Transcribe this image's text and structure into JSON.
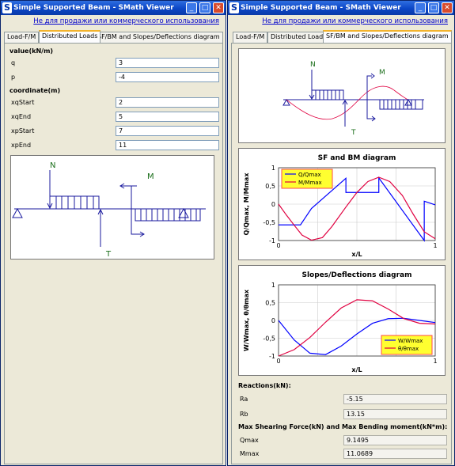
{
  "window_title": "Simple Supported Beam - SMath Viewer",
  "license_link": "Не для продажи или коммерческого использования",
  "tabs": [
    "Load-F/M",
    "Distributed Loads",
    "SF/BM and Slopes/Deflections diagram"
  ],
  "left": {
    "value_header": "value(kN/m)",
    "q_label": "q",
    "q": "3",
    "p_label": "p",
    "p": "-4",
    "coord_header": "coordinate(m)",
    "xqStart_label": "xqStart",
    "xqStart": "2",
    "xqEnd_label": "xqEnd",
    "xqEnd": "5",
    "xpStart_label": "xpStart",
    "xpStart": "7",
    "xpEnd_label": "xpEnd",
    "xpEnd": "11"
  },
  "beam_labels": {
    "N": "N",
    "M": "M",
    "T": "T"
  },
  "right": {
    "reactions_header": "Reactions(kN):",
    "ra_label": "Ra",
    "ra": "-5.15",
    "rb_label": "Rb",
    "rb": "13.15",
    "max_header": "Max Shearing Force(kN) and Max Bending moment(kN*m):",
    "qmax_label": "Qmax",
    "qmax": "9.1495",
    "mmax_label": "Mmax",
    "mmax": "11.0689"
  },
  "chart_data": [
    {
      "type": "line",
      "title": "SF and BM diagram",
      "xlabel": "x/L",
      "ylabel": "Q/Qmax, M/Mmax",
      "xlim": [
        0,
        1
      ],
      "ylim": [
        -1,
        1
      ],
      "xticks": [
        "0",
        "1"
      ],
      "yticks": [
        "1",
        "0,5",
        "0",
        "-0,5",
        "-1"
      ],
      "legend": "top-left",
      "series": [
        {
          "name": "Q/Qmax",
          "color": "#0000ff",
          "x": [
            0,
            0.14,
            0.21,
            0.43,
            0.43,
            0.64,
            0.64,
            0.93,
            0.93,
            1
          ],
          "y": [
            -0.57,
            -0.57,
            -0.12,
            0.71,
            0.32,
            0.32,
            0.72,
            -1.0,
            0.08,
            -0.02
          ]
        },
        {
          "name": "M/Mmax",
          "color": "#e00040",
          "x": [
            0,
            0.05,
            0.1,
            0.15,
            0.21,
            0.28,
            0.34,
            0.43,
            0.5,
            0.57,
            0.64,
            0.71,
            0.79,
            0.86,
            0.93,
            1
          ],
          "y": [
            0,
            -0.3,
            -0.58,
            -0.85,
            -0.99,
            -0.92,
            -0.62,
            -0.08,
            0.32,
            0.62,
            0.74,
            0.62,
            0.24,
            -0.28,
            -0.76,
            -0.95
          ]
        }
      ]
    },
    {
      "type": "line",
      "title": "Slopes/Deflections diagram",
      "xlabel": "x/L",
      "ylabel": "W/Wmax, θ/θmax",
      "xlim": [
        0,
        1
      ],
      "ylim": [
        -1,
        1
      ],
      "xticks": [
        "0",
        "1"
      ],
      "yticks": [
        "1",
        "0,5",
        "0",
        "-0,5",
        "-1"
      ],
      "legend": "bottom-right",
      "series": [
        {
          "name": "W/Wmax",
          "color": "#0000ff",
          "x": [
            0,
            0.1,
            0.2,
            0.3,
            0.4,
            0.5,
            0.6,
            0.7,
            0.8,
            0.9,
            1
          ],
          "y": [
            0,
            -0.55,
            -0.92,
            -0.96,
            -0.72,
            -0.38,
            -0.08,
            0.05,
            0.06,
            0.0,
            -0.06
          ]
        },
        {
          "name": "θ/θmax",
          "color": "#e00040",
          "x": [
            0,
            0.1,
            0.2,
            0.3,
            0.4,
            0.5,
            0.6,
            0.7,
            0.8,
            0.9,
            1
          ],
          "y": [
            -1,
            -0.82,
            -0.48,
            -0.05,
            0.35,
            0.58,
            0.55,
            0.32,
            0.05,
            -0.08,
            -0.1
          ]
        }
      ]
    }
  ]
}
